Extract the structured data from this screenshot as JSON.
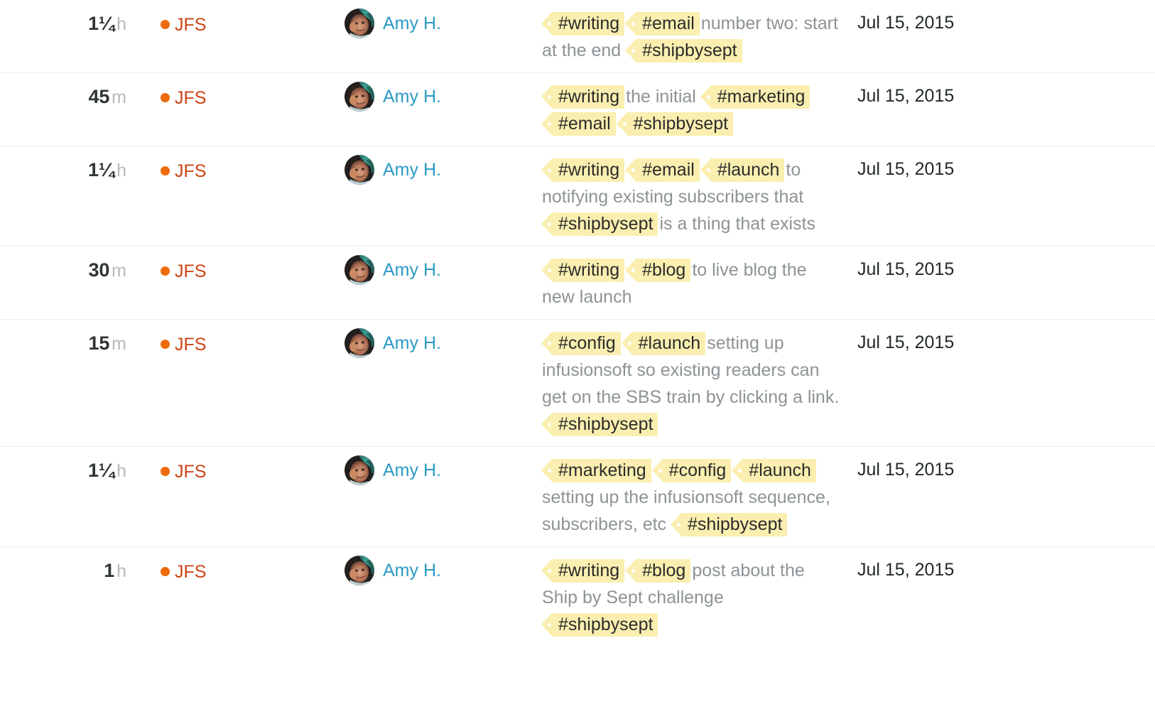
{
  "view": {
    "name": "time-entries-list",
    "colors": {
      "tag_background": "#faefb0",
      "tag_text": "#2b2b2b",
      "project_dot": "#ee6a0b",
      "project_text": "#cc4415",
      "user_link": "#2c9ac4",
      "muted_text": "#8d9396",
      "row_divider": "#eceded",
      "date_text": "#22282b",
      "duration_value": "#2f3437",
      "duration_unit": "#b4b9bb",
      "page_background": "#ffffff"
    },
    "icons": {
      "project_dot": "dot-icon",
      "avatar": "user-avatar-photo"
    }
  },
  "entries": [
    {
      "duration_value": "1¼",
      "duration_unit": "h",
      "project": "JFS",
      "user": "Amy H.",
      "date": "Jul 15, 2015",
      "description": [
        {
          "type": "tag",
          "text": "#writing"
        },
        {
          "type": "tag",
          "text": "#email"
        },
        {
          "type": "text",
          "text": "number two: start at the end"
        },
        {
          "type": "tag",
          "text": "#shipbysept"
        }
      ]
    },
    {
      "duration_value": "45",
      "duration_unit": "m",
      "project": "JFS",
      "user": "Amy H.",
      "date": "Jul 15, 2015",
      "description": [
        {
          "type": "tag",
          "text": "#writing"
        },
        {
          "type": "text",
          "text": "the initial"
        },
        {
          "type": "tag",
          "text": "#marketing"
        },
        {
          "type": "tag",
          "text": "#email"
        },
        {
          "type": "tag",
          "text": "#shipbysept"
        }
      ]
    },
    {
      "duration_value": "1¼",
      "duration_unit": "h",
      "project": "JFS",
      "user": "Amy H.",
      "date": "Jul 15, 2015",
      "description": [
        {
          "type": "tag",
          "text": "#writing"
        },
        {
          "type": "tag",
          "text": "#email"
        },
        {
          "type": "tag",
          "text": "#launch"
        },
        {
          "type": "text",
          "text": "to notifying existing subscribers that"
        },
        {
          "type": "tag",
          "text": "#shipbysept"
        },
        {
          "type": "text",
          "text": "is a thing that exists"
        }
      ]
    },
    {
      "duration_value": "30",
      "duration_unit": "m",
      "project": "JFS",
      "user": "Amy H.",
      "date": "Jul 15, 2015",
      "description": [
        {
          "type": "tag",
          "text": "#writing"
        },
        {
          "type": "tag",
          "text": "#blog"
        },
        {
          "type": "text",
          "text": "to live blog the new launch"
        }
      ]
    },
    {
      "duration_value": "15",
      "duration_unit": "m",
      "project": "JFS",
      "user": "Amy H.",
      "date": "Jul 15, 2015",
      "description": [
        {
          "type": "tag",
          "text": "#config"
        },
        {
          "type": "tag",
          "text": "#launch"
        },
        {
          "type": "text",
          "text": "setting up infusionsoft so existing readers can get on the SBS train by clicking a link."
        },
        {
          "type": "tag",
          "text": "#shipbysept"
        }
      ]
    },
    {
      "duration_value": "1¼",
      "duration_unit": "h",
      "project": "JFS",
      "user": "Amy H.",
      "date": "Jul 15, 2015",
      "description": [
        {
          "type": "tag",
          "text": "#marketing"
        },
        {
          "type": "tag",
          "text": "#config"
        },
        {
          "type": "tag",
          "text": "#launch"
        },
        {
          "type": "text",
          "text": "setting up the infusionsoft sequence, subscribers, etc"
        },
        {
          "type": "tag",
          "text": "#shipbysept"
        }
      ]
    },
    {
      "duration_value": "1",
      "duration_unit": "h",
      "project": "JFS",
      "user": "Amy H.",
      "date": "Jul 15, 2015",
      "description": [
        {
          "type": "tag",
          "text": "#writing"
        },
        {
          "type": "tag",
          "text": "#blog"
        },
        {
          "type": "text",
          "text": "post about the Ship by Sept challenge"
        },
        {
          "type": "tag",
          "text": "#shipbysept"
        }
      ]
    }
  ]
}
